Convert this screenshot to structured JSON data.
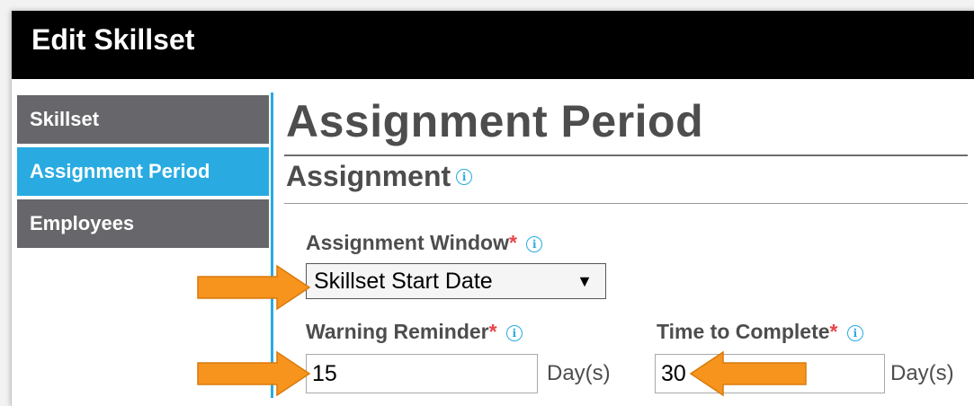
{
  "window": {
    "title": "Edit Skillset"
  },
  "sidebar": {
    "items": [
      {
        "label": "Skillset",
        "active": false
      },
      {
        "label": "Assignment Period",
        "active": true
      },
      {
        "label": "Employees",
        "active": false
      }
    ]
  },
  "main": {
    "page_title": "Assignment Period",
    "section_title": "Assignment",
    "assignment_window": {
      "label": "Assignment Window",
      "required_mark": "*",
      "selected": "Skillset Start Date"
    },
    "warning_reminder": {
      "label": "Warning Reminder",
      "required_mark": "*",
      "value": "15",
      "unit": "Day(s)"
    },
    "time_to_complete": {
      "label": "Time to Complete",
      "required_mark": "*",
      "value": "30",
      "unit": "Day(s)"
    }
  },
  "icons": {
    "info": "info-icon",
    "dropdown": "triangle-down-icon",
    "annotation": "orange-arrow"
  },
  "colors": {
    "accent": "#29abe2",
    "nav": "#66666b",
    "required": "#e8454d",
    "arrow": "#f7941d"
  }
}
